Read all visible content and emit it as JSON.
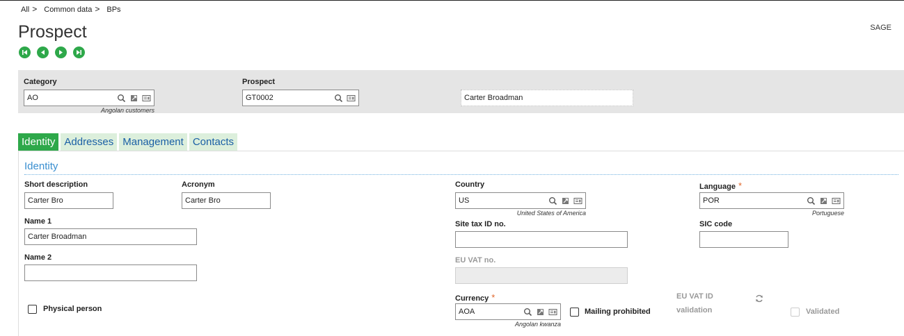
{
  "breadcrumb": {
    "items": [
      "All",
      "Common data",
      "BPs"
    ],
    "separator": ">"
  },
  "page": {
    "title": "Prospect",
    "user": "SAGE"
  },
  "nav_icons": [
    "first-record-icon",
    "previous-record-icon",
    "next-record-icon",
    "last-record-icon"
  ],
  "colors": {
    "accent": "#2ea84a",
    "link": "#1a5fa5",
    "section": "#3a8fd0",
    "required": "#e0662b",
    "panel": "#e5e5e5"
  },
  "header": {
    "category": {
      "label": "Category",
      "value": "AO",
      "description": "Angolan customers"
    },
    "prospect": {
      "label": "Prospect",
      "value": "GT0002"
    },
    "name": "Carter Broadman"
  },
  "tabs": [
    {
      "label": "Identity",
      "active": true
    },
    {
      "label": "Addresses",
      "active": false
    },
    {
      "label": "Management",
      "active": false
    },
    {
      "label": "Contacts",
      "active": false
    }
  ],
  "identity": {
    "section_title": "Identity",
    "short_description": {
      "label": "Short description",
      "value": "Carter Bro"
    },
    "acronym": {
      "label": "Acronym",
      "value": "Carter Bro"
    },
    "name1": {
      "label": "Name 1",
      "value": "Carter Broadman"
    },
    "name2": {
      "label": "Name 2",
      "value": ""
    },
    "physical_person": {
      "label": "Physical person",
      "checked": false
    },
    "country": {
      "label": "Country",
      "value": "US",
      "description": "United States of America"
    },
    "site_tax_id": {
      "label": "Site tax ID no.",
      "value": ""
    },
    "eu_vat": {
      "label": "EU VAT no.",
      "value": ""
    },
    "currency": {
      "label": "Currency",
      "required_mark": "*",
      "value": "AOA",
      "description": "Angolan kwanza"
    },
    "mailing_prohibited": {
      "label": "Mailing prohibited",
      "checked": false
    },
    "language": {
      "label": "Language",
      "required_mark": "*",
      "value": "POR",
      "description": "Portuguese"
    },
    "sic_code": {
      "label": "SIC code",
      "value": ""
    },
    "eu_vat_validation": {
      "label_line1": "EU VAT ID",
      "label_line2": "validation"
    },
    "validated": {
      "label": "Validated",
      "checked": false
    }
  }
}
